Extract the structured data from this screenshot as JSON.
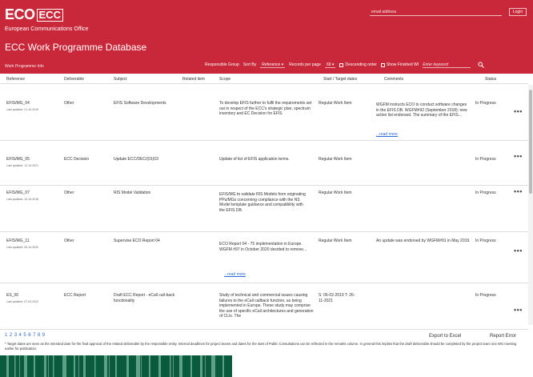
{
  "header": {
    "logo_eco": "ECO",
    "logo_ecc": "ECC",
    "org_name": "European Communications Office",
    "db_title": "ECC Work Programme Database",
    "wp_info": "Work Programme Info",
    "email_placeholder": "email address",
    "login_label": "Login",
    "bg_color": "#c8283a"
  },
  "filters": {
    "responsible_group": "Responsible Group",
    "sort_by_label": "Sort By",
    "sort_by_value": "Reference",
    "records_label": "Records per page",
    "records_value": "69",
    "descending_label": "Descending order",
    "show_finished_label": "Show Finished WI",
    "search_placeholder": "Enter keyword"
  },
  "table": {
    "headers": [
      "Reference",
      "Deliverable",
      "Subject",
      "Related item",
      "Scope",
      "Start / Target dates",
      "Comments",
      "Status"
    ],
    "rows": [
      {
        "ref": "EFIS/MG_04",
        "updated": "Last updated: 21-10-2019",
        "deliverable": "Other",
        "subject": "EFIS Software Developments",
        "scope": "To develop EFIS further to fulfil the requirements set out in respect of the ECC's strategic plan, spectrum inventory and EC Decision for EFIS",
        "dates": "Regular Work Item",
        "comments": "WGFM instructs ECO to conduct software changes in the EFIS DB. WGFM#92 (September 2018): new action list endorsed. The summary of the EFIS...",
        "readmore": "...read more",
        "status": "In Progress"
      },
      {
        "ref": "EFIS/MG_05",
        "updated": "Last updated: 12-10-2021",
        "deliverable": "ECC Decision",
        "subject": "Update ECC/DEC/(01)03",
        "scope": "Update of list of EFIS application terms.",
        "dates": "Regular Work Item",
        "comments": "",
        "readmore": "",
        "status": "In Progress"
      },
      {
        "ref": "EFIS/MG_07",
        "updated": "Last updated: 10-10-2018",
        "deliverable": "Other",
        "subject": "RIS Model Validation",
        "scope": "EFIS/MG to validate RIS Models from originating PPs/MGs concerning compliance with the NS Model template guidance and compatibility with the EFIS DB.",
        "dates": "Regular Work Item",
        "comments": "",
        "readmore": "",
        "status": "In Progress"
      },
      {
        "ref": "EFIS/MG_11",
        "updated": "Last updated: 26-10-2020",
        "deliverable": "Other",
        "subject": "Supervise ECO Report 04",
        "scope": "ECO Report 04 - 75 implementation in Europe. WGFM #97 in October 2020 decided to remove...",
        "dates": "Regular Work Item",
        "comments": "An update was endorsed by WGFM#91 in May 2019.",
        "readmore": "...read more",
        "status": "In Progress"
      },
      {
        "ref": "ES_06",
        "updated": "Last updated: 07-03-2022",
        "deliverable": "ECC Report",
        "subject": "Draft ECC Report - eCall call-back functionality",
        "scope": "Study of technical and commercial issues causing failures to the eCall callback function, as being implemented in Europe. These study may comprise the use of specific eCall architectures and generation of CLIs. The",
        "dates": "S: 06-02-2019 T: 26-11-2021",
        "comments": "",
        "readmore": "",
        "status": "In Progress"
      }
    ]
  },
  "pagination": [
    "1",
    "2",
    "3",
    "4",
    "5",
    "6",
    "7",
    "8",
    "9"
  ],
  "actions": {
    "export_label": "Export to Excel",
    "report_label": "Report Error"
  },
  "footnote": "* Target dates are seen as the intended date for the final approval of the related deliverable by the responsible entity. Internal deadlines for project teams and dates for the start of Public Consultations can be reflected in the remarks column. In general this implies that the draft deliverable should be completed by the project team one WG meeting earlier for publication.",
  "colors": {
    "accent": "#c8283a",
    "link": "#2a6ad1",
    "footer_green": "#0a5a3d"
  }
}
